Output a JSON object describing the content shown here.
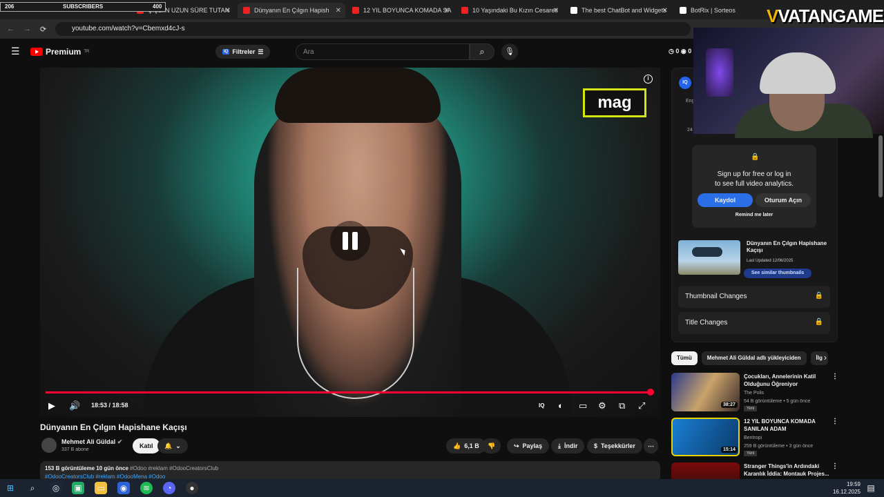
{
  "subs_bar": {
    "current": "206",
    "label": "SUBSCRIBERS",
    "goal": "400"
  },
  "tabs": [
    {
      "label": "ÇİŞLİİN UZUN SÜRE TUTAN"
    },
    {
      "label": "Dünyanın En Çılgın Hapish"
    },
    {
      "label": "12 YIL BOYUNCA KOMADA SA"
    },
    {
      "label": "10 Yaşındaki Bu Kızın Cesareti"
    },
    {
      "label": "The best ChatBot and Widgets"
    },
    {
      "label": "BotRix | Sorteos"
    }
  ],
  "address": {
    "url": "youtube.com/watch?v=Cbemxd4cJ-s"
  },
  "header": {
    "logo": "Premium",
    "region": "TR",
    "filter": "Filtreler",
    "search_placeholder": "Ara",
    "counter_a": "0",
    "counter_b": "0"
  },
  "video": {
    "logo_text": "mag",
    "time": "18:53 / 18:58",
    "progress": 0.997
  },
  "meta": {
    "title": "Dünyanın En Çılgın Hapishane Kaçışı",
    "channel": "Mehmet Ali Güldal",
    "subscribers": "337 B abone",
    "join": "Katıl",
    "likes": "6,1 B",
    "share": "Paylaş",
    "download": "İndir",
    "thanks": "Teşekkürler"
  },
  "description": {
    "views": "153 B görüntüleme",
    "ago": "10 gün önce",
    "tags1": "#Odoo #reklam #OdooCreatorsClub",
    "tags2": "#OdooCreatorsClub #reklam #OdooMena #Odoo"
  },
  "vidiq": {
    "badge": "IQ",
    "popup_line1": "Sign up for free or log in",
    "popup_line2": "to see full video analytics.",
    "signup": "Kaydol",
    "login": "Oturum Açın",
    "remind": "Remind me later",
    "thumb_title": "Dünyanın En Çılgın Hapishane Kaçışı",
    "last_updated": "Last Updated 12/06/2025",
    "similar": "See similar thumbnails",
    "row1": "Thumbnail Changes",
    "row2": "Title Changes",
    "partial_a": "Eng",
    "partial_b": "24"
  },
  "chips": [
    "Tümü",
    "Mehmet Ali Güldal adlı yükleyiciden",
    "İlg"
  ],
  "recommendations": [
    {
      "title": "Çocukları, Annelerinin Katil Olduğunu Öğreniyor",
      "channel": "The Polis",
      "meta": "54 B görüntüleme • 5 gün önce",
      "badge": "Yeni",
      "duration": "38:27"
    },
    {
      "title": "12 YIL BOYUNCA KOMADA SANILAN ADAM",
      "channel": "Bentropi",
      "meta": "259 B görüntüleme • 3 gün önce",
      "badge": "Yeni",
      "duration": "15:14"
    },
    {
      "title": "Stranger Things'in Ardındaki Karanlık İddia: Montauk Projes...",
      "channel": "",
      "meta": "",
      "badge": "",
      "duration": ""
    }
  ],
  "overlay": {
    "brand_v": "V",
    "brand_rest": "VATANGAME"
  },
  "taskbar": {
    "time": "19:59",
    "date": "16.12.2025"
  }
}
